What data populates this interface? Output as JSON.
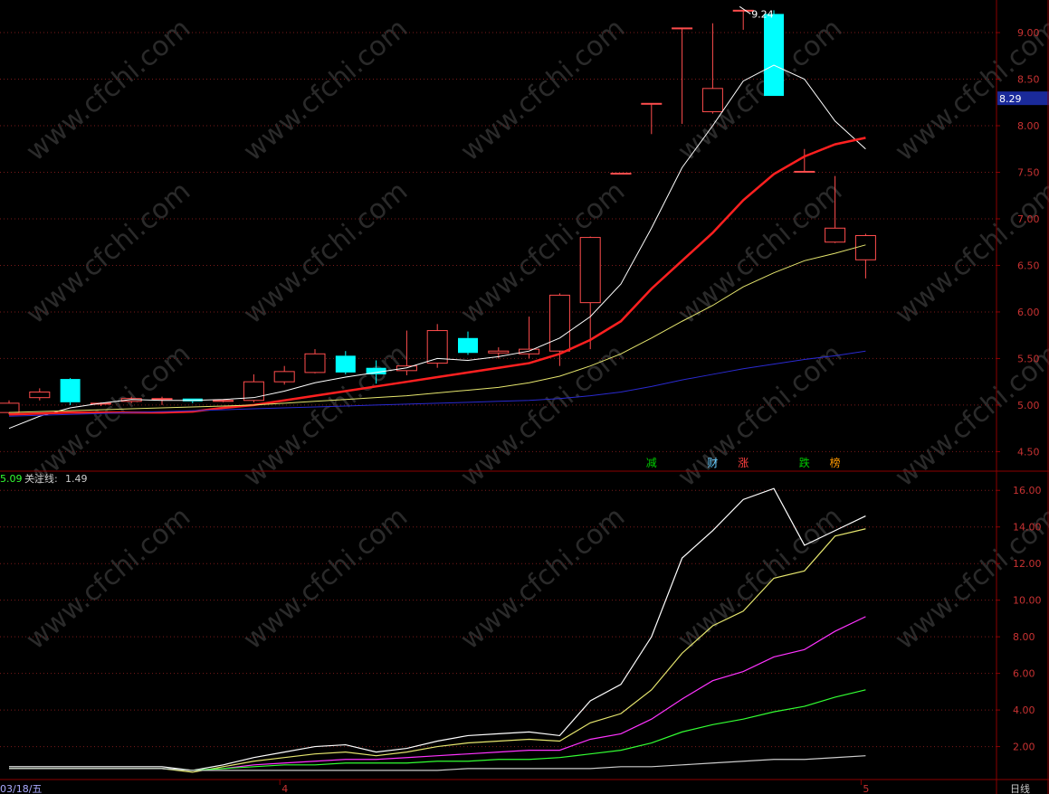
{
  "colors": {
    "background": "#000000",
    "frame": "#8b0000",
    "grid": "#7a1a1a",
    "up": "#ff4d4d",
    "down": "#00ffff",
    "ma5": "#ffffff",
    "ma10": "#ff2020",
    "ma20": "#e6e66e",
    "ma60": "#2a2ad0",
    "axis_text": "#c83232"
  },
  "watermark_text": "www.cfchi.com",
  "price_axis": {
    "ticks": [
      "4.50",
      "5.00",
      "5.50",
      "6.00",
      "6.50",
      "7.00",
      "7.50",
      "8.00",
      "8.50",
      "9.00"
    ],
    "tick_values": [
      4.5,
      5.0,
      5.5,
      6.0,
      6.5,
      7.0,
      7.5,
      8.0,
      8.5,
      9.0
    ],
    "range": [
      4.3,
      9.35
    ],
    "current_price": "8.29",
    "current_price_value": 8.29,
    "high_label": "9.24",
    "high_value": 9.24
  },
  "indicator_axis": {
    "ticks": [
      "2.00",
      "4.00",
      "6.00",
      "8.00",
      "10.00",
      "12.00",
      "14.00",
      "16.00"
    ],
    "tick_values": [
      2,
      4,
      6,
      8,
      10,
      12,
      14,
      16
    ],
    "range": [
      0.2,
      17.0
    ]
  },
  "indicator_header": {
    "value1": "5.09",
    "label": "关注线:",
    "value2": "1.49"
  },
  "x_axis": {
    "first_label": "03/18/五",
    "month_labels": [
      {
        "label": "4",
        "index": 9
      },
      {
        "label": "5",
        "index": 28
      }
    ],
    "period": "日线"
  },
  "signal_labels": [
    {
      "text": "减",
      "color": "#00cc00",
      "index": 21
    },
    {
      "text": "财",
      "color": "#66ccff",
      "index": 23
    },
    {
      "text": "涨",
      "color": "#ff4040",
      "index": 24
    },
    {
      "text": "跌",
      "color": "#00cc00",
      "index": 26
    },
    {
      "text": "榜",
      "color": "#ff9900",
      "index": 27
    }
  ],
  "chart_data": {
    "type": "candlestick",
    "candles": [
      {
        "o": 4.92,
        "c": 5.02,
        "h": 5.05,
        "l": 4.9
      },
      {
        "o": 5.08,
        "c": 5.14,
        "h": 5.18,
        "l": 5.05
      },
      {
        "o": 5.28,
        "c": 5.03,
        "h": 5.29,
        "l": 5.0
      },
      {
        "o": 5.01,
        "c": 5.02,
        "h": 5.03,
        "l": 4.99
      },
      {
        "o": 5.04,
        "c": 5.07,
        "h": 5.09,
        "l": 5.02
      },
      {
        "o": 5.06,
        "c": 5.07,
        "h": 5.09,
        "l": 5.0
      },
      {
        "o": 5.07,
        "c": 5.04,
        "h": 5.07,
        "l": 5.02
      },
      {
        "o": 5.04,
        "c": 5.05,
        "h": 5.06,
        "l": 5.03
      },
      {
        "o": 5.05,
        "c": 5.25,
        "h": 5.33,
        "l": 5.03
      },
      {
        "o": 5.25,
        "c": 5.36,
        "h": 5.42,
        "l": 5.22
      },
      {
        "o": 5.35,
        "c": 5.55,
        "h": 5.6,
        "l": 5.34
      },
      {
        "o": 5.53,
        "c": 5.35,
        "h": 5.58,
        "l": 5.33
      },
      {
        "o": 5.4,
        "c": 5.33,
        "h": 5.48,
        "l": 5.23
      },
      {
        "o": 5.37,
        "c": 5.42,
        "h": 5.8,
        "l": 5.32
      },
      {
        "o": 5.45,
        "c": 5.8,
        "h": 5.87,
        "l": 5.4
      },
      {
        "o": 5.72,
        "c": 5.56,
        "h": 5.79,
        "l": 5.54
      },
      {
        "o": 5.56,
        "c": 5.58,
        "h": 5.62,
        "l": 5.5
      },
      {
        "o": 5.55,
        "c": 5.6,
        "h": 5.95,
        "l": 5.5
      },
      {
        "o": 5.58,
        "c": 6.18,
        "h": 6.2,
        "l": 5.42
      },
      {
        "o": 6.1,
        "c": 6.8,
        "h": 6.81,
        "l": 5.6
      },
      {
        "o": 7.49,
        "c": 7.49,
        "h": 7.49,
        "l": 7.49
      },
      {
        "o": 8.24,
        "c": 8.24,
        "h": 8.24,
        "l": 7.91
      },
      {
        "o": 9.05,
        "c": 9.05,
        "h": 9.05,
        "l": 8.02
      },
      {
        "o": 8.15,
        "c": 8.4,
        "h": 9.1,
        "l": 8.13
      },
      {
        "o": 9.24,
        "c": 9.24,
        "h": 9.24,
        "l": 9.03
      },
      {
        "o": 9.2,
        "c": 8.32,
        "h": 9.24,
        "l": 8.32
      },
      {
        "o": 7.51,
        "c": 7.51,
        "h": 7.75,
        "l": 7.51
      },
      {
        "o": 6.75,
        "c": 6.9,
        "h": 7.46,
        "l": 6.74
      },
      {
        "o": 6.56,
        "c": 6.82,
        "h": 6.84,
        "l": 6.36
      }
    ],
    "ma_series": [
      {
        "key": "ma5",
        "values": [
          4.75,
          4.88,
          4.97,
          5.02,
          5.06,
          5.05,
          5.05,
          5.06,
          5.08,
          5.15,
          5.24,
          5.3,
          5.35,
          5.4,
          5.5,
          5.48,
          5.52,
          5.58,
          5.72,
          5.95,
          6.3,
          6.9,
          7.55,
          8.0,
          8.48,
          8.65,
          8.5,
          8.05,
          7.75
        ]
      },
      {
        "key": "ma10",
        "values": [
          4.9,
          4.91,
          4.92,
          4.92,
          4.92,
          4.92,
          4.93,
          4.97,
          5.0,
          5.05,
          5.1,
          5.15,
          5.2,
          5.25,
          5.3,
          5.35,
          5.4,
          5.45,
          5.55,
          5.7,
          5.9,
          6.25,
          6.55,
          6.85,
          7.2,
          7.48,
          7.67,
          7.8,
          7.87
        ]
      },
      {
        "key": "ma20",
        "values": [
          4.92,
          4.93,
          4.94,
          4.95,
          4.96,
          4.97,
          4.98,
          4.99,
          5.0,
          5.02,
          5.04,
          5.06,
          5.08,
          5.1,
          5.13,
          5.16,
          5.19,
          5.24,
          5.31,
          5.42,
          5.55,
          5.72,
          5.9,
          6.07,
          6.27,
          6.42,
          6.55,
          6.63,
          6.72
        ]
      },
      {
        "key": "ma60",
        "values": [
          4.88,
          4.89,
          4.9,
          4.91,
          4.92,
          4.93,
          4.94,
          4.95,
          4.96,
          4.97,
          4.98,
          4.99,
          5.0,
          5.01,
          5.02,
          5.03,
          5.04,
          5.05,
          5.07,
          5.1,
          5.14,
          5.2,
          5.27,
          5.33,
          5.39,
          5.44,
          5.49,
          5.53,
          5.58
        ]
      }
    ],
    "indicator_series": [
      {
        "key": "white",
        "color": "#ffffff",
        "values": [
          0.9,
          0.9,
          0.9,
          0.9,
          0.9,
          0.9,
          0.7,
          1.0,
          1.4,
          1.7,
          2.0,
          2.1,
          1.7,
          1.9,
          2.3,
          2.6,
          2.7,
          2.8,
          2.6,
          4.5,
          5.4,
          8.0,
          12.3,
          13.8,
          15.5,
          16.1,
          13.0,
          13.8,
          14.6
        ]
      },
      {
        "key": "yellow",
        "color": "#e6e66e",
        "values": [
          0.8,
          0.8,
          0.8,
          0.8,
          0.8,
          0.8,
          0.6,
          0.9,
          1.2,
          1.4,
          1.6,
          1.7,
          1.5,
          1.7,
          2.0,
          2.2,
          2.3,
          2.4,
          2.3,
          3.3,
          3.8,
          5.1,
          7.1,
          8.6,
          9.4,
          11.2,
          11.6,
          13.5,
          13.9
        ]
      },
      {
        "key": "magenta",
        "color": "#ff33ff",
        "values": [
          0.8,
          0.8,
          0.8,
          0.8,
          0.8,
          0.8,
          0.7,
          0.8,
          1.0,
          1.1,
          1.2,
          1.3,
          1.3,
          1.4,
          1.5,
          1.6,
          1.7,
          1.8,
          1.8,
          2.4,
          2.7,
          3.5,
          4.6,
          5.6,
          6.1,
          6.9,
          7.3,
          8.3,
          9.1
        ]
      },
      {
        "key": "green",
        "color": "#33ff33",
        "values": [
          0.8,
          0.8,
          0.8,
          0.8,
          0.8,
          0.8,
          0.7,
          0.8,
          0.9,
          1.0,
          1.0,
          1.1,
          1.1,
          1.1,
          1.2,
          1.2,
          1.3,
          1.3,
          1.4,
          1.6,
          1.8,
          2.2,
          2.8,
          3.2,
          3.5,
          3.9,
          4.2,
          4.7,
          5.1
        ]
      },
      {
        "key": "grey",
        "color": "#cccccc",
        "values": [
          0.8,
          0.8,
          0.8,
          0.8,
          0.8,
          0.8,
          0.7,
          0.7,
          0.7,
          0.7,
          0.7,
          0.7,
          0.7,
          0.7,
          0.7,
          0.8,
          0.8,
          0.8,
          0.8,
          0.8,
          0.9,
          0.9,
          1.0,
          1.1,
          1.2,
          1.3,
          1.3,
          1.4,
          1.5
        ]
      }
    ]
  }
}
